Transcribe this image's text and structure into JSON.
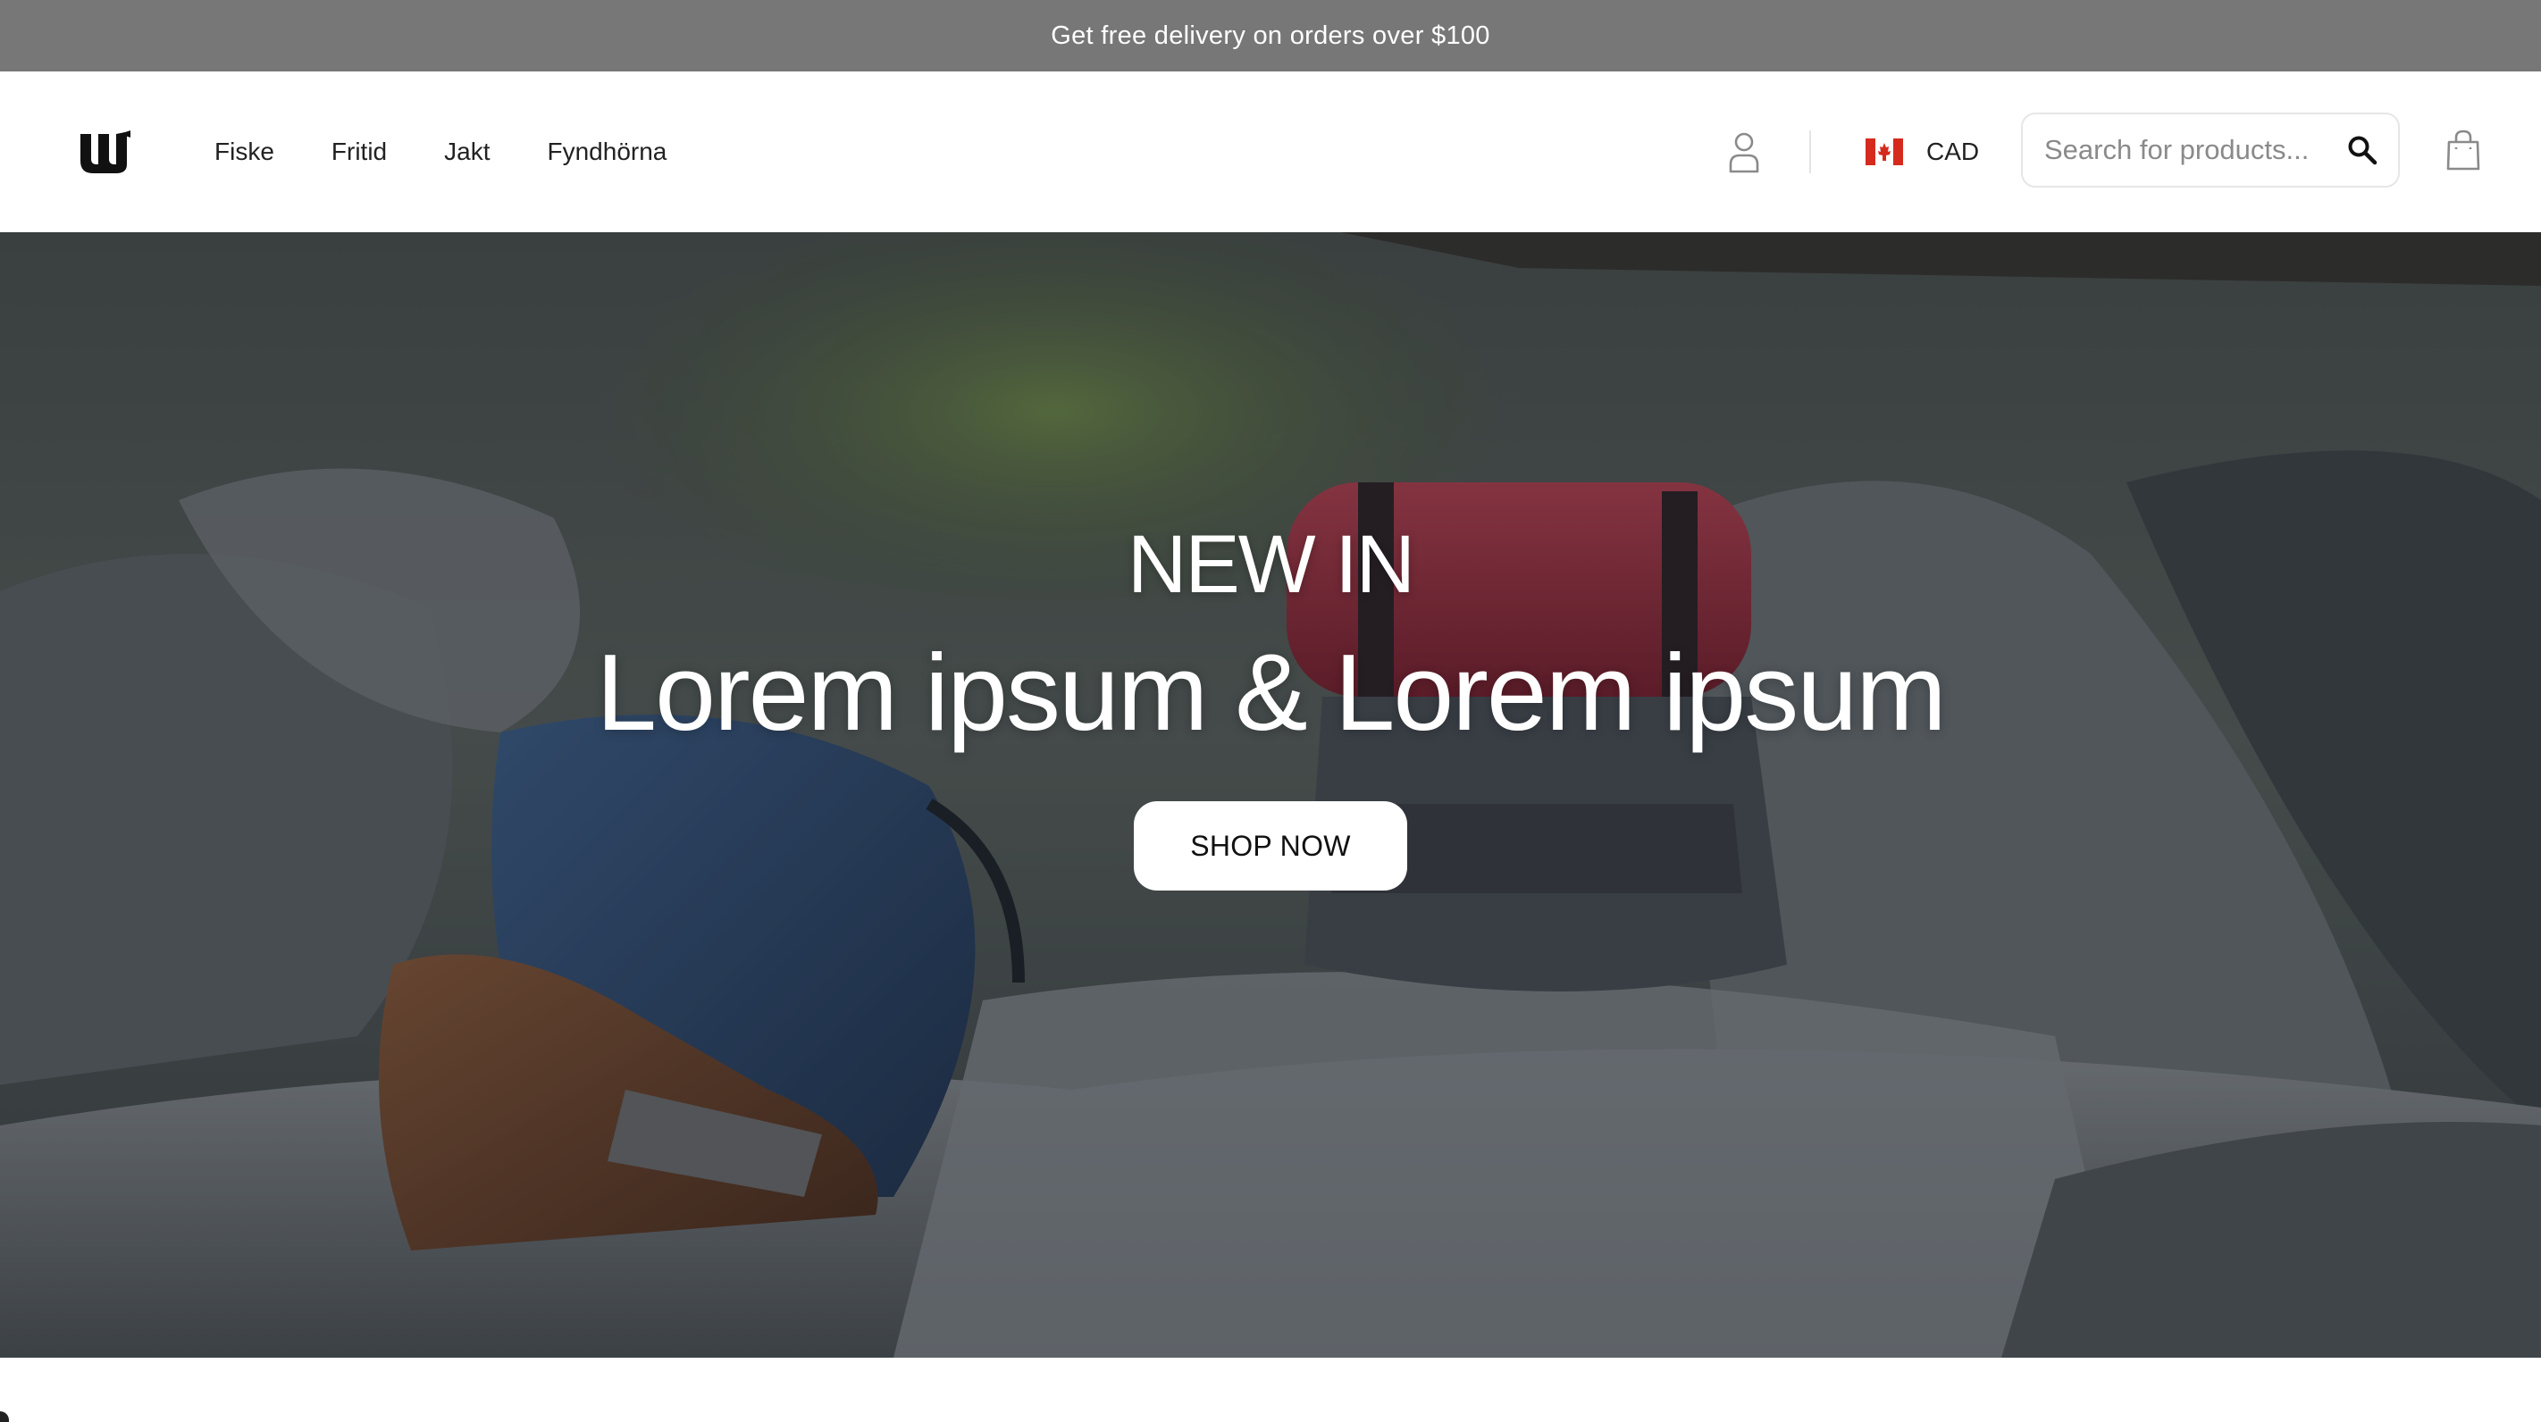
{
  "announcement": {
    "text": "Get free delivery on orders over $100"
  },
  "header": {
    "nav": [
      {
        "label": "Fiske"
      },
      {
        "label": "Fritid"
      },
      {
        "label": "Jakt"
      },
      {
        "label": "Fyndhörna"
      }
    ],
    "currency": {
      "code": "CAD",
      "flag": "canada-flag-icon"
    },
    "search": {
      "placeholder": "Search for products..."
    },
    "icons": {
      "account": "user-icon",
      "search": "search-icon",
      "cart": "shopping-bag-icon"
    }
  },
  "hero": {
    "eyebrow": "NEW IN",
    "headline": "Lorem ipsum & Lorem ipsum",
    "cta_label": "SHOP NOW"
  },
  "colors": {
    "announcement_bg": "#777777",
    "text": "#222222",
    "flag_red": "#d52b1e",
    "button_bg": "#ffffff"
  }
}
